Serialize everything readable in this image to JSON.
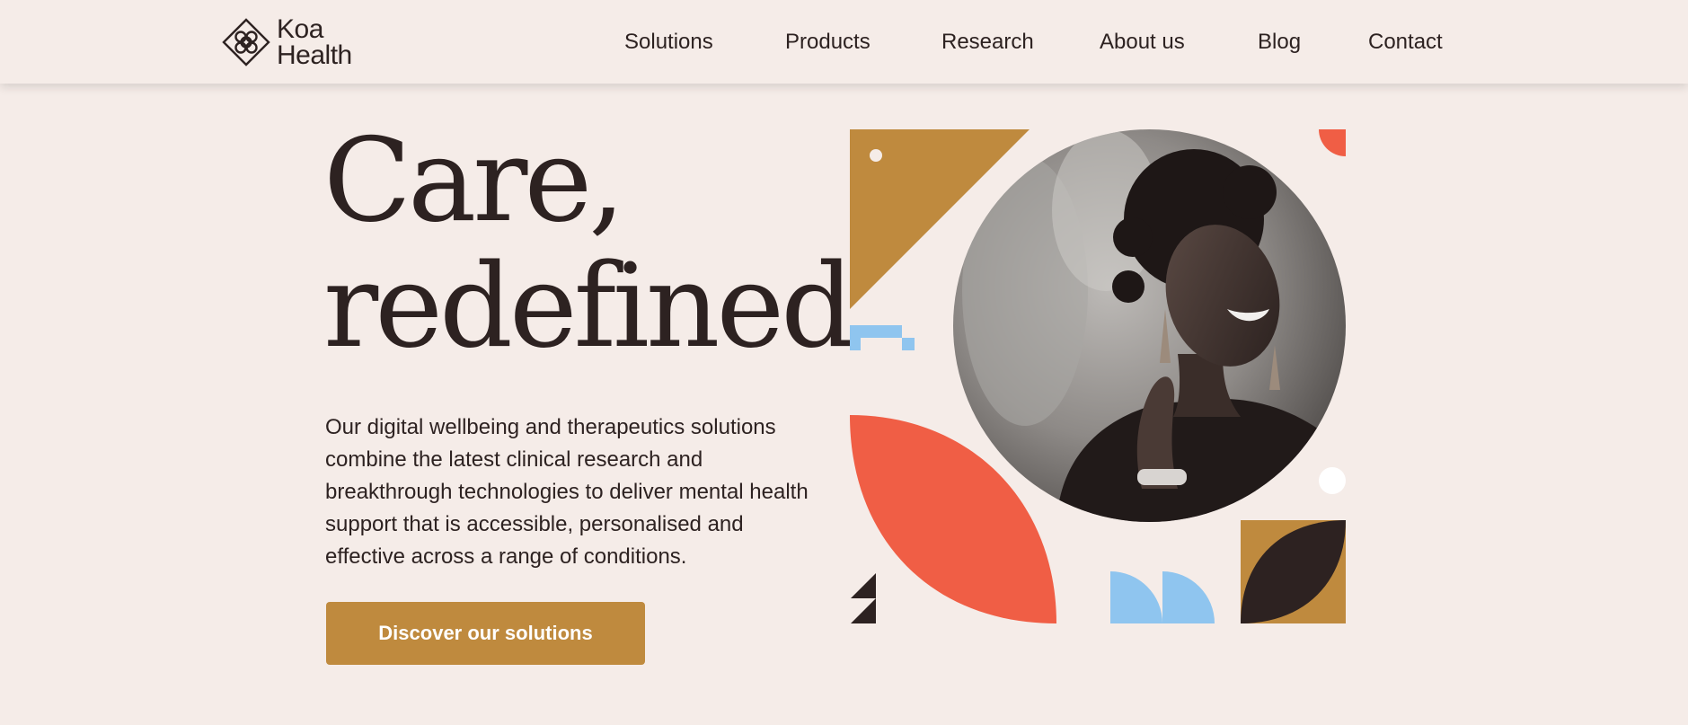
{
  "brand": {
    "name_line1": "Koa",
    "name_line2": "Health"
  },
  "nav": {
    "items": [
      {
        "label": "Solutions"
      },
      {
        "label": "Products"
      },
      {
        "label": "Research"
      },
      {
        "label": "About us"
      },
      {
        "label": "Blog"
      },
      {
        "label": "Contact"
      }
    ]
  },
  "hero": {
    "title_line1": "Care,",
    "title_line2": "redefined",
    "description": "Our digital wellbeing and therapeutics solutions combine the latest clinical research and breakthrough technologies to deliver mental health support that is accessible, personalised and effective across a range of conditions.",
    "cta_label": "Discover our solutions"
  },
  "colors": {
    "background": "#f5ece8",
    "text": "#2d2221",
    "gold": "#bf8a3e",
    "coral": "#f05e45",
    "sky": "#8fc5ef",
    "dark": "#2d2221"
  },
  "icons": {
    "logo": "koa-diamond-logo-icon"
  }
}
